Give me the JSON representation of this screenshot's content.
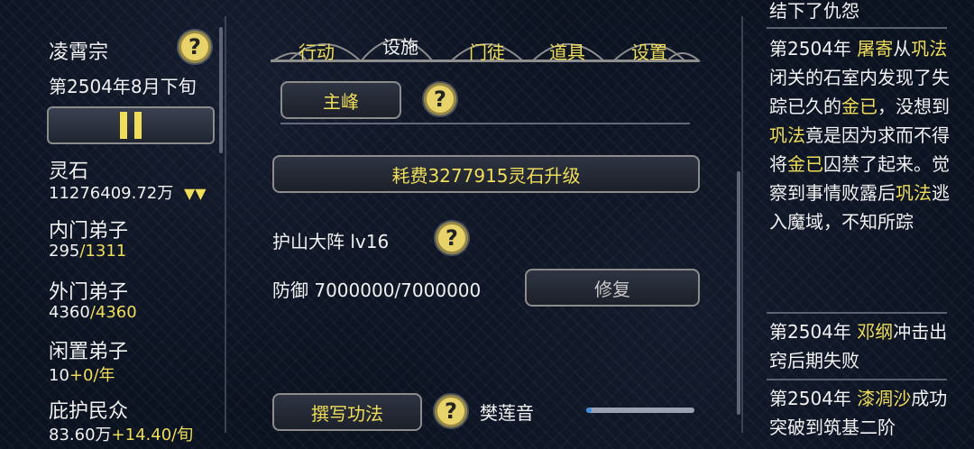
{
  "left": {
    "sect_name": "凌霄宗",
    "date": "第2504年8月下旬",
    "lingshi_label": "灵石",
    "lingshi_value": "11276409.72万",
    "lingshi_arrow": "▼▼",
    "inner_label": "内门弟子",
    "inner_cur": "295",
    "inner_max": "/1311",
    "outer_label": "外门弟子",
    "outer_cur": "4360",
    "outer_max": "/4360",
    "idle_label": "闲置弟子",
    "idle_cur": "10",
    "idle_rate": "+0/年",
    "protect_label": "庇护民众",
    "protect_cur": "83.60万",
    "protect_rate": "+14.40/旬"
  },
  "tabs": [
    "行动",
    "设施",
    "门徒",
    "道具",
    "设置"
  ],
  "middle": {
    "peak_label": "主峰",
    "upgrade_label": "耗费3277915灵石升级",
    "array_label": "护山大阵 lv16",
    "defense_label": "防御 7000000/7000000",
    "repair_label": "修复",
    "write_label": "撰写功法",
    "author": "樊莲音",
    "progress": 0.05
  },
  "log": {
    "e0": "结下了仇怨",
    "e1_year": "第2504年 ",
    "e1_name1": "屠寄",
    "e1_t1": "从",
    "e1_name2a": "巩",
    "e1_name2b": "法",
    "e1_t2": "闭关的石室内发现了失踪已久的",
    "e1_name3a": "金",
    "e1_name3b": "已",
    "e1_t3": "，没想到",
    "e1_name4": "巩法",
    "e1_t4": "竟是因为求而不得将",
    "e1_name5": "金已",
    "e1_t5": "囚禁了起来。觉察到事情败露后",
    "e1_name6": "巩法",
    "e1_t6": "逃入魔域，不知所踪",
    "e2_year": "第2504年 ",
    "e2_name": "邓纲",
    "e2_t1": "冲击出窍后期失败",
    "e3_year": "第2504年 ",
    "e3_name": "漆凋沙",
    "e3_t1": "成功突破到筑基二阶"
  },
  "colors": {
    "accent": "#f0de5b",
    "text": "#f1f1f1",
    "frame": "#8c8c8c"
  },
  "icons": [
    "help-icon",
    "pause-icon"
  ]
}
